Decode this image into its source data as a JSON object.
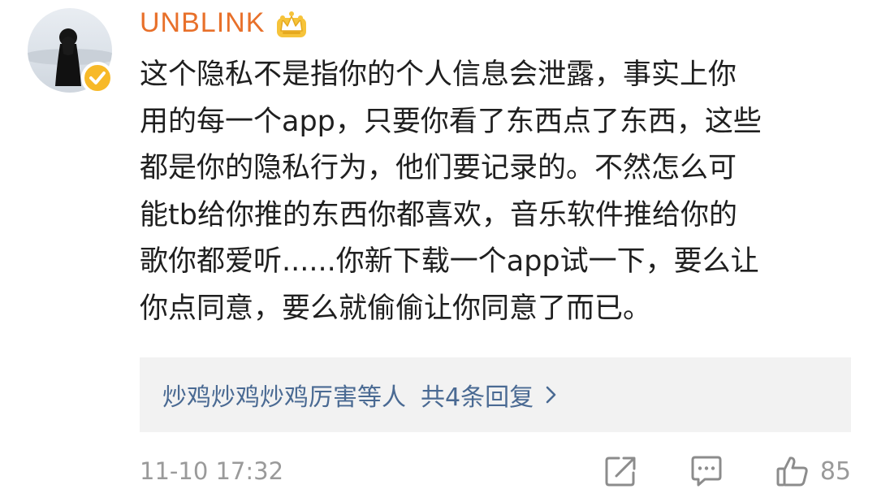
{
  "user": {
    "name": "UNBLINK"
  },
  "comment": {
    "lines": [
      "这个隐私不是指你的个人信息会泄露，事实上你",
      "用的每一个app，只要你看了东西点了东西，这些",
      "都是你的隐私行为，他们要记录的。不然怎么可",
      "能tb给你推的东西你都喜欢，音乐软件推给你的",
      "歌你都爱听......你新下载一个app试一下，要么让",
      "你点同意，要么就偷偷让你同意了而已。"
    ]
  },
  "replies": {
    "repliers": "炒鸡炒鸡炒鸡厉害等人",
    "count_label": "共4条回复"
  },
  "footer": {
    "timestamp": "11-10 17:32",
    "like_count": "85"
  },
  "colors": {
    "username": "#e8702a",
    "reply_link": "#4a6a93",
    "meta_gray": "#9a9a9a",
    "verified_badge": "#f7b928"
  },
  "icons": {
    "crown": "crown-icon",
    "verified": "verified-badge-icon",
    "share": "share-icon",
    "comment": "comment-icon",
    "like": "thumbs-up-icon",
    "chevron": "chevron-right-icon"
  }
}
